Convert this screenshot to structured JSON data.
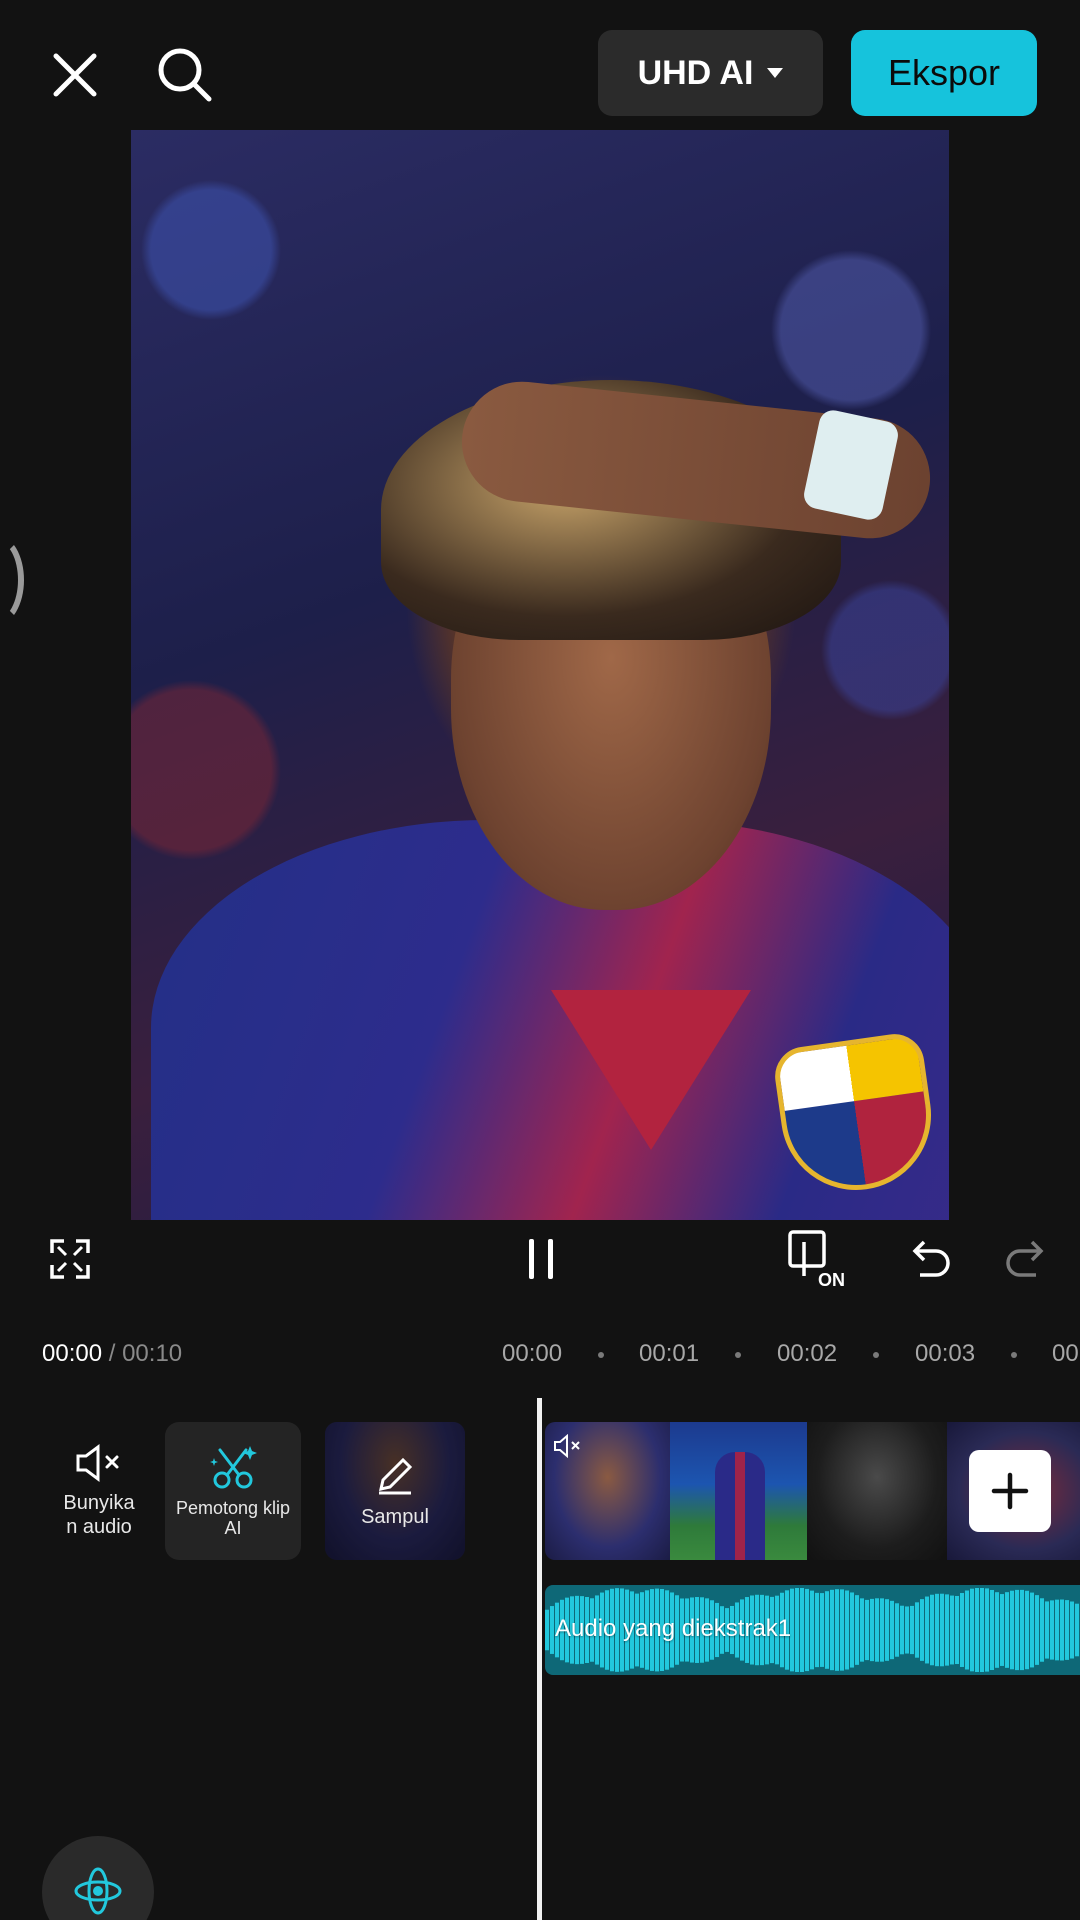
{
  "header": {
    "quality_label": "UHD AI",
    "export_label": "Ekspor"
  },
  "player": {
    "current_time": "00:00",
    "separator": " / ",
    "total_time": "00:10",
    "keyframe_badge": "ON"
  },
  "ruler": {
    "labels": [
      "00:00",
      "00:01",
      "00:02",
      "00:03",
      "00"
    ]
  },
  "tools": {
    "mute_label": "Bunyikan audio",
    "mute_line1": "Bunyika",
    "mute_line2": "n audio",
    "aicut_line1": "Pemotong klip",
    "aicut_line2": "AI",
    "cover_label": "Sampul"
  },
  "audio": {
    "track_label": "Audio yang diekstrak1"
  },
  "icons": {
    "close": "close-icon",
    "search": "search-icon",
    "dropdown": "caret-down-icon",
    "fullscreen": "fullscreen-icon",
    "pause": "pause-icon",
    "keyframe": "keyframe-icon",
    "undo": "undo-icon",
    "redo": "redo-icon",
    "mute": "speaker-mute-icon",
    "ai_cut": "scissors-sparkle-icon",
    "cover": "pencil-icon",
    "add": "plus-icon",
    "effects": "orbit-icon"
  },
  "colors": {
    "background": "#121212",
    "accent": "#16c3dc",
    "audio_track": "#0e6877",
    "audio_wave": "#22c8dd"
  }
}
